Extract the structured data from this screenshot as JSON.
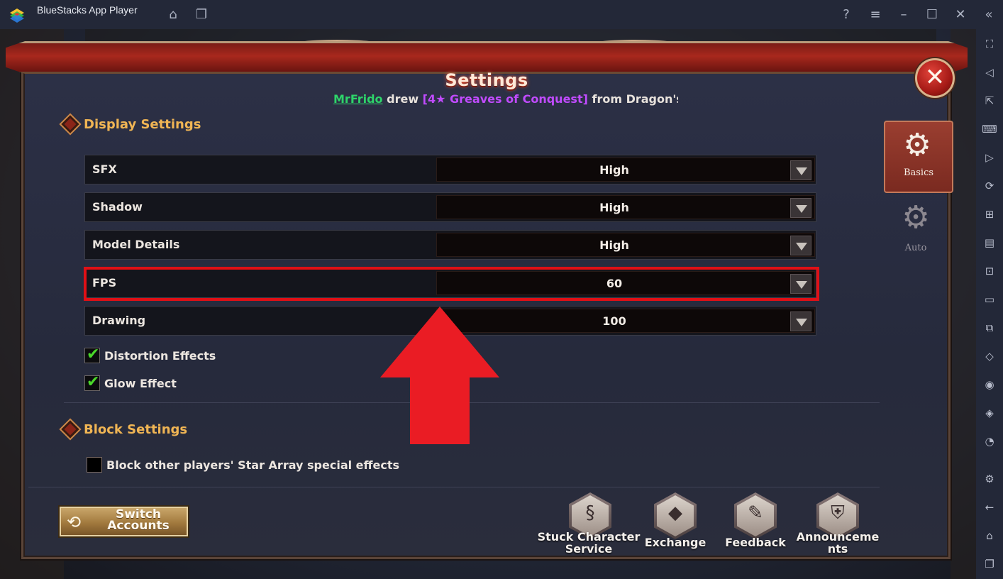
{
  "window": {
    "title": "BlueStacks App Player",
    "controls": [
      "help-icon",
      "menu-icon",
      "minimize-icon",
      "maximize-icon",
      "close-icon",
      "collapse-sidebar-icon"
    ]
  },
  "settings": {
    "title": "Settings",
    "close_symbol": "✕",
    "ticker": {
      "player": "MrFrido",
      "verb": " drew ",
      "item": "[4★ Greaves of Conquest]",
      "rest": " from Dragon's Tr"
    },
    "display_section": {
      "label": "Display Settings",
      "rows": [
        {
          "label": "SFX",
          "value": "High"
        },
        {
          "label": "Shadow",
          "value": "High"
        },
        {
          "label": "Model Details",
          "value": "High"
        },
        {
          "label": "FPS",
          "value": "60"
        },
        {
          "label": "Drawing",
          "value": "100"
        }
      ],
      "checkboxes": [
        {
          "label": "Distortion Effects",
          "checked": true
        },
        {
          "label": "Glow Effect",
          "checked": true
        }
      ]
    },
    "block_section": {
      "label": "Block Settings",
      "checkboxes": [
        {
          "label": "Block other players' Star Array special effects",
          "checked": false
        }
      ]
    },
    "buttons": {
      "switch_accounts": "Switch\nAccounts",
      "stuck": "Stuck Character Service",
      "exchange": "Exchange",
      "feedback": "Feedback",
      "announcements": "Announcements"
    },
    "tabs": {
      "basics": "Basics",
      "auto": "Auto"
    }
  },
  "colors": {
    "highlight": "#e01016",
    "section_label": "#f0b554",
    "ticker_player": "#2ed46a",
    "ticker_item": "#c14bff"
  }
}
